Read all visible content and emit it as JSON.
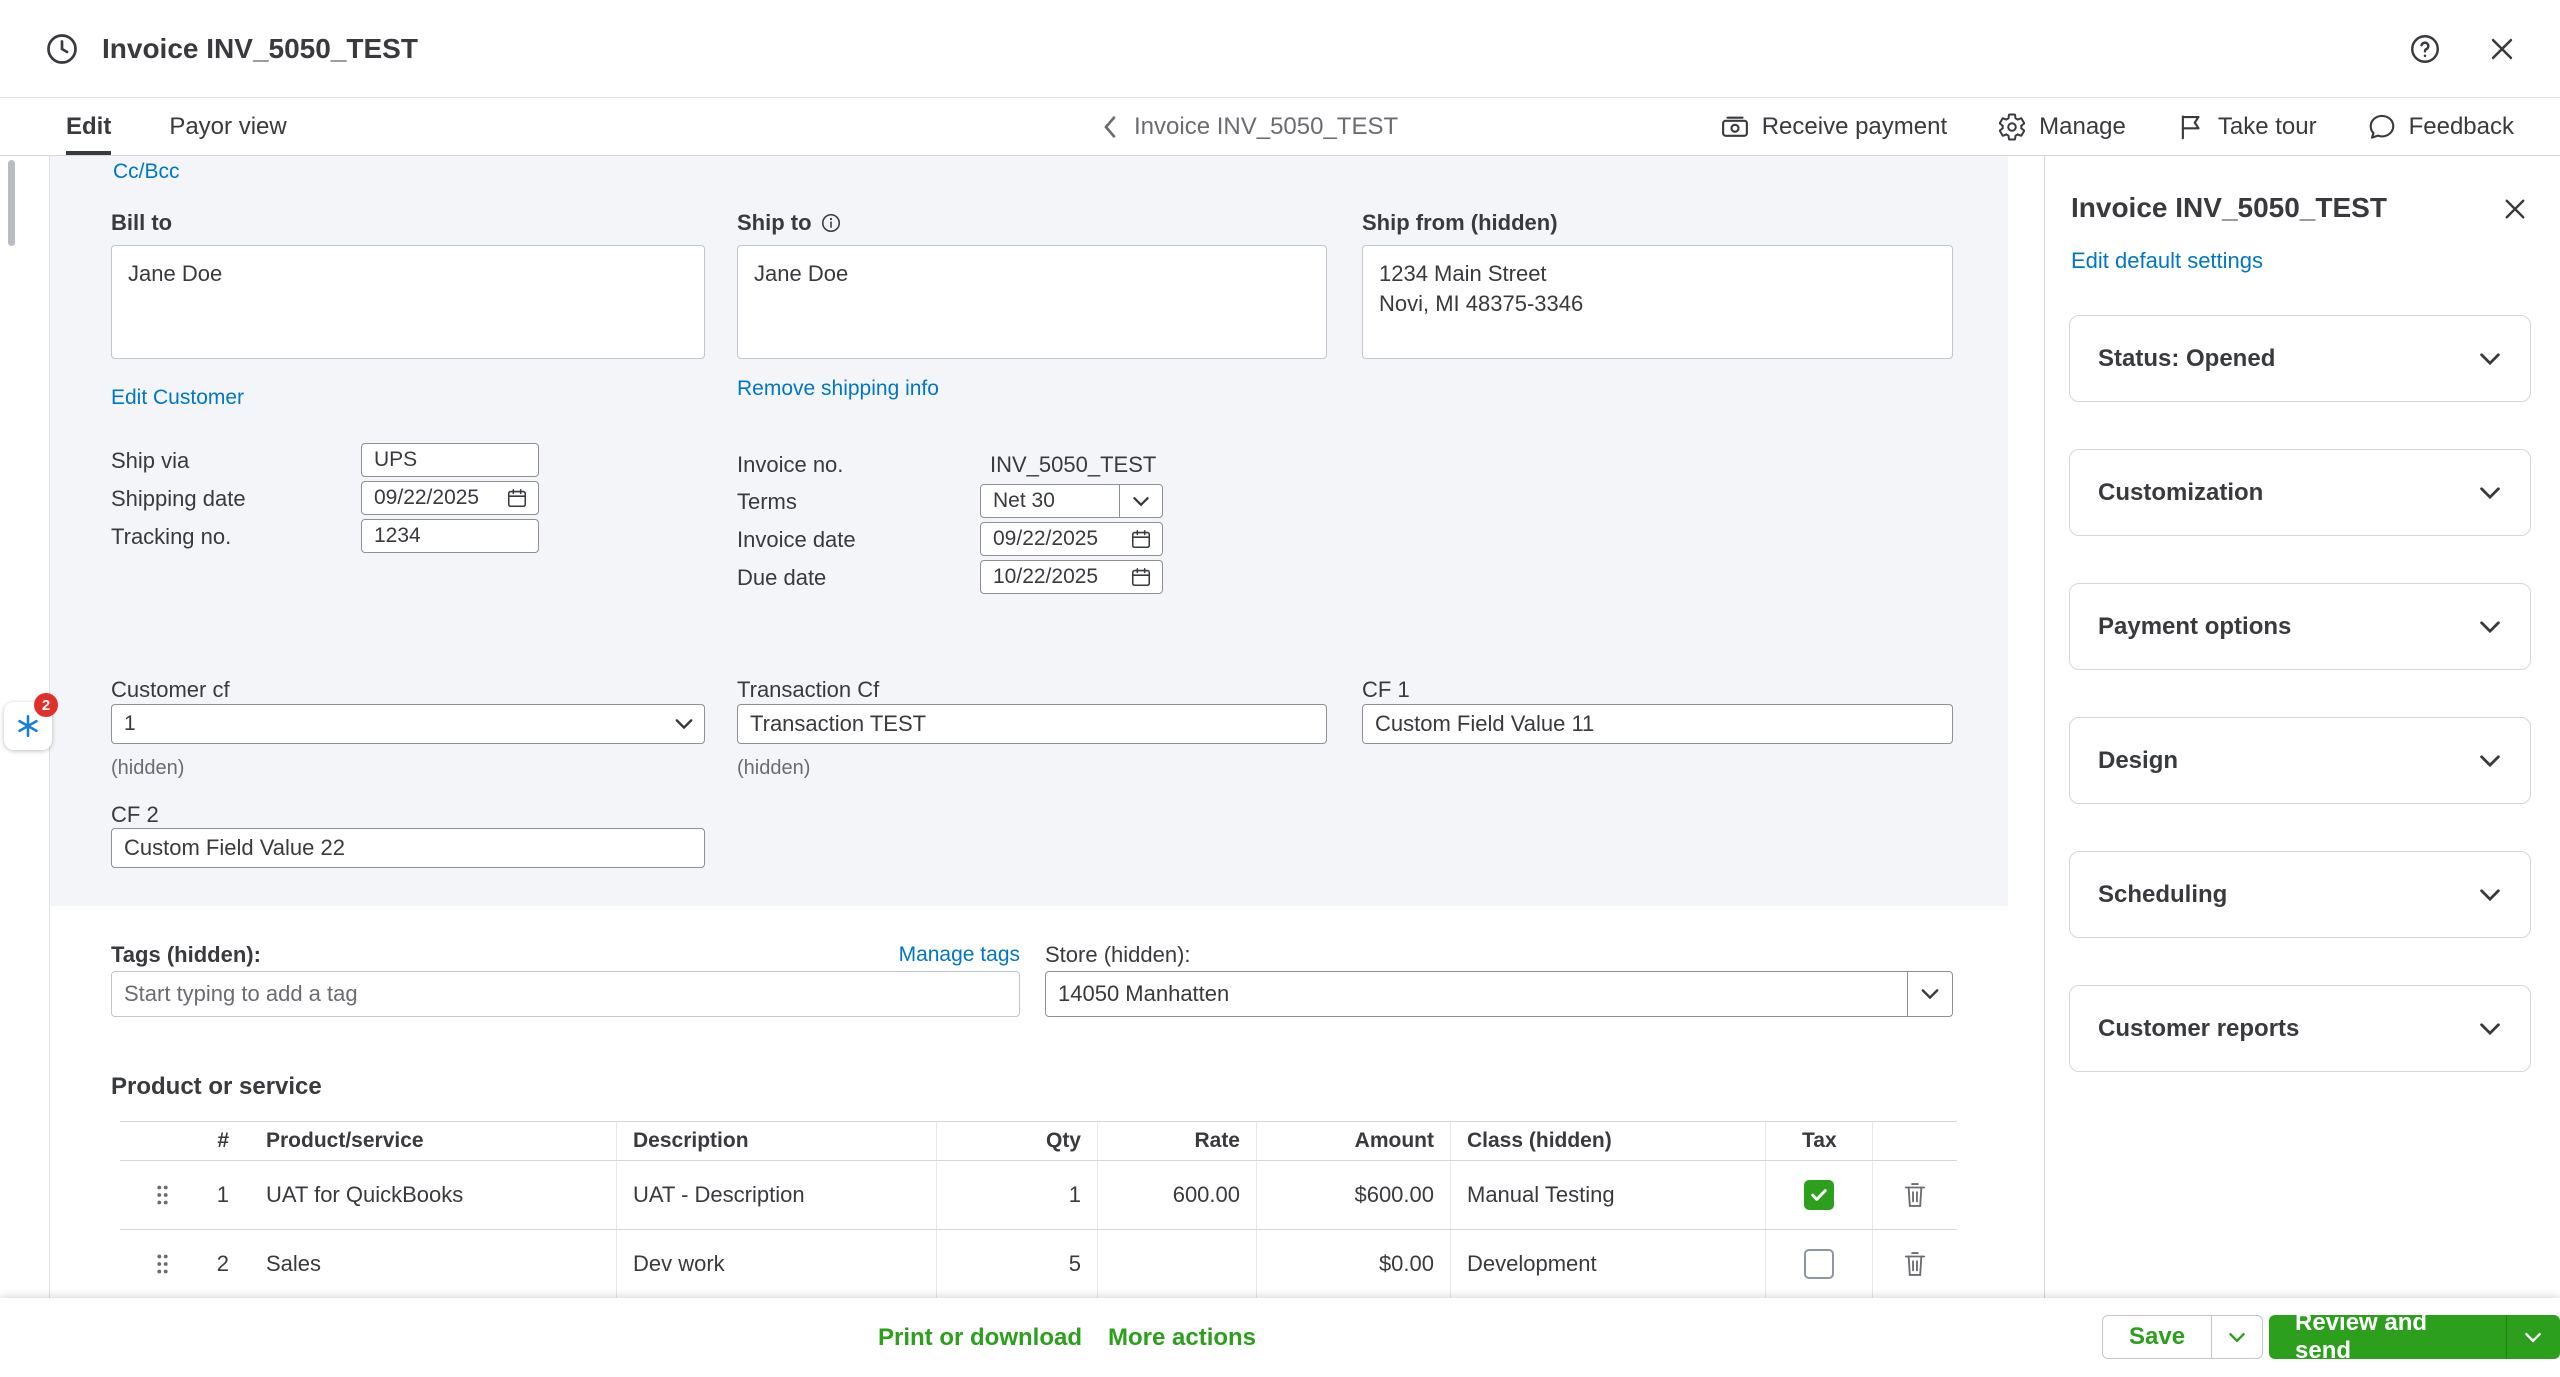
{
  "header": {
    "title": "Invoice INV_5050_TEST"
  },
  "navbar": {
    "tabs": [
      {
        "label": "Edit"
      },
      {
        "label": "Payor view"
      }
    ],
    "breadcrumb": "Invoice INV_5050_TEST",
    "actions": [
      {
        "label": "Receive payment"
      },
      {
        "label": "Manage"
      },
      {
        "label": "Take tour"
      },
      {
        "label": "Feedback"
      }
    ]
  },
  "form": {
    "cc_bcc": "Cc/Bcc",
    "bill_to": {
      "label": "Bill to",
      "value": "Jane Doe"
    },
    "ship_to": {
      "label": "Ship to",
      "value": "Jane Doe"
    },
    "ship_from": {
      "label": "Ship from (hidden)",
      "value": "1234 Main Street\nNovi, MI 48375-3346"
    },
    "edit_customer": "Edit Customer",
    "remove_shipping": "Remove shipping info",
    "ship_via": {
      "label": "Ship via",
      "value": "UPS"
    },
    "shipping_date": {
      "label": "Shipping date",
      "value": "09/22/2025"
    },
    "tracking_no": {
      "label": "Tracking no.",
      "value": "1234"
    },
    "invoice_no": {
      "label": "Invoice no.",
      "value": "INV_5050_TEST"
    },
    "terms": {
      "label": "Terms",
      "value": "Net 30"
    },
    "invoice_date": {
      "label": "Invoice date",
      "value": "09/22/2025"
    },
    "due_date": {
      "label": "Due date",
      "value": "10/22/2025"
    },
    "customer_cf": {
      "label": "Customer cf",
      "value": "1",
      "note": "(hidden)"
    },
    "transaction_cf": {
      "label": "Transaction Cf",
      "value": "Transaction TEST",
      "note": "(hidden)"
    },
    "cf1": {
      "label": "CF 1",
      "value": "Custom Field Value 11"
    },
    "cf2": {
      "label": "CF 2",
      "value": "Custom Field Value 22"
    }
  },
  "tags": {
    "label": "Tags (hidden):",
    "manage": "Manage tags",
    "placeholder": "Start typing to add a tag"
  },
  "store": {
    "label": "Store (hidden):",
    "value": "14050 Manhatten"
  },
  "products": {
    "heading": "Product or service",
    "columns": [
      "#",
      "Product/service",
      "Description",
      "Qty",
      "Rate",
      "Amount",
      "Class (hidden)",
      "Tax"
    ],
    "rows": [
      {
        "num": "1",
        "product": "UAT for QuickBooks",
        "description": "UAT - Description",
        "qty": "1",
        "rate": "600.00",
        "amount": "$600.00",
        "class": "Manual Testing",
        "tax": true
      },
      {
        "num": "2",
        "product": "Sales",
        "description": "Dev work",
        "qty": "5",
        "rate": "",
        "amount": "$0.00",
        "class": "Development",
        "tax": false
      }
    ]
  },
  "sidebar": {
    "title": "Invoice INV_5050_TEST",
    "edit_defaults": "Edit default settings",
    "sections": [
      {
        "label": "Status: Opened"
      },
      {
        "label": "Customization"
      },
      {
        "label": "Payment options"
      },
      {
        "label": "Design"
      },
      {
        "label": "Scheduling"
      },
      {
        "label": "Customer reports"
      }
    ]
  },
  "footer": {
    "print": "Print or download",
    "more": "More actions",
    "save": "Save",
    "send": "Review and send"
  },
  "widget": {
    "badge": "2"
  },
  "colors": {
    "green": "#2ca01c",
    "link_blue": "#0077c5",
    "text": "#393a3d"
  }
}
